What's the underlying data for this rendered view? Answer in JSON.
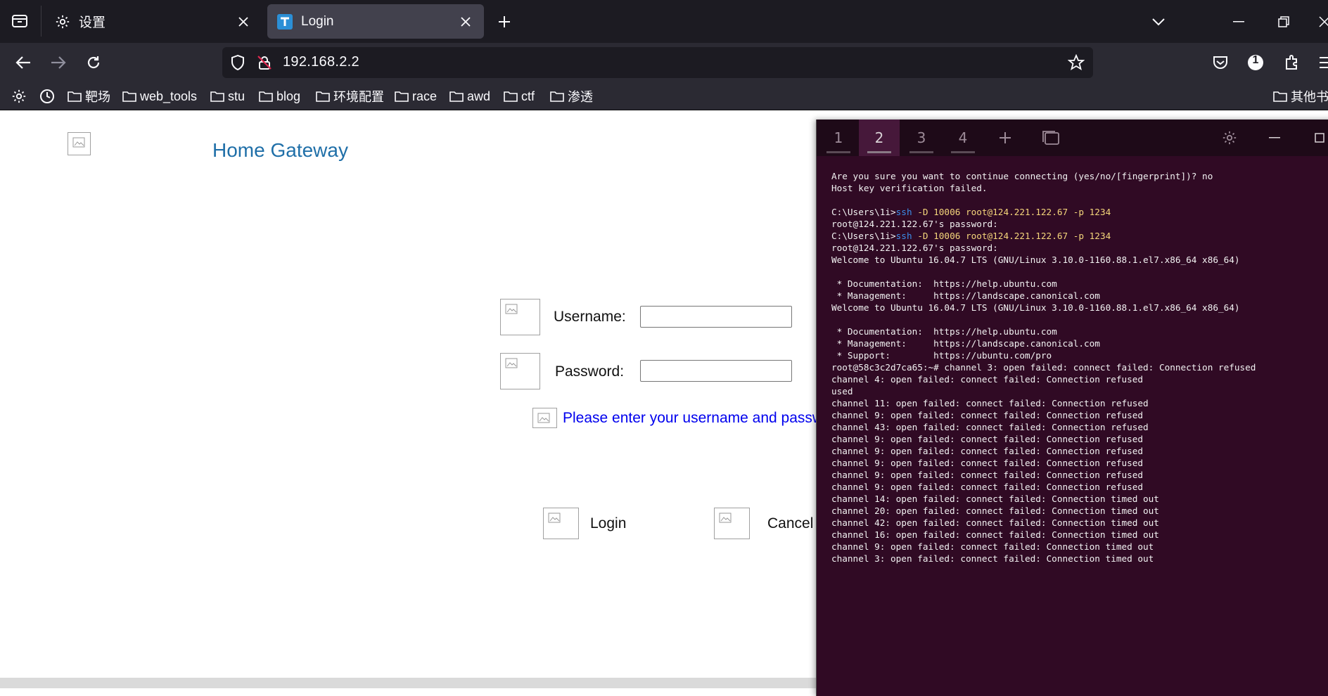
{
  "browser": {
    "tabs": [
      {
        "title": "设置",
        "active": false
      },
      {
        "title": "Login",
        "active": true
      }
    ],
    "url": "192.168.2.2",
    "bookmarks": [
      "靶场",
      "web_tools",
      "stu",
      "blog",
      "环境配置",
      "race",
      "awd",
      "ctf",
      "渗透"
    ],
    "other_bookmarks": "其他书",
    "extension_badge": "1",
    "colors": {
      "tabbar": "#1c1b22",
      "toolbar": "#2b2a33",
      "active_tab": "#42414d"
    }
  },
  "page": {
    "title": "Home Gateway",
    "username_label": "Username:",
    "password_label": "Password:",
    "username_value": "",
    "password_value": "",
    "hint": "Please enter your username and passwor",
    "login_label": "Login",
    "cancel_label": "Cancel",
    "colors": {
      "title": "#1f6fa8",
      "hint": "#0000ee"
    }
  },
  "terminal": {
    "tabs": [
      "1",
      "2",
      "3",
      "4"
    ],
    "active_tab": "2",
    "colors": {
      "background": "#300a24",
      "command": "#3b8eea",
      "argument": "#f5d67b"
    },
    "lines": [
      {
        "text": "Are you sure you want to continue connecting (yes/no/[fingerprint])? no"
      },
      {
        "text": "Host key verification failed."
      },
      {
        "text": ""
      },
      {
        "prompt": "C:\\Users\\1i>",
        "cmd": "ssh",
        "args": " -D 10006 root@124.221.122.67 -p 1234"
      },
      {
        "text": "root@124.221.122.67's password:"
      },
      {
        "prompt": "C:\\Users\\1i>",
        "cmd": "ssh",
        "args": " -D 10006 root@124.221.122.67 -p 1234"
      },
      {
        "text": "root@124.221.122.67's password:"
      },
      {
        "text": "Welcome to Ubuntu 16.04.7 LTS (GNU/Linux 3.10.0-1160.88.1.el7.x86_64 x86_64)"
      },
      {
        "text": ""
      },
      {
        "text": " * Documentation:  https://help.ubuntu.com"
      },
      {
        "text": " * Management:     https://landscape.canonical.com"
      },
      {
        "text": "Welcome to Ubuntu 16.04.7 LTS (GNU/Linux 3.10.0-1160.88.1.el7.x86_64 x86_64)"
      },
      {
        "text": ""
      },
      {
        "text": " * Documentation:  https://help.ubuntu.com"
      },
      {
        "text": " * Management:     https://landscape.canonical.com"
      },
      {
        "text": " * Support:        https://ubuntu.com/pro"
      },
      {
        "text": "root@58c3c2d7ca65:~# channel 3: open failed: connect failed: Connection refused"
      },
      {
        "text": "channel 4: open failed: connect failed: Connection refused"
      },
      {
        "text": "used"
      },
      {
        "text": "channel 11: open failed: connect failed: Connection refused"
      },
      {
        "text": "channel 9: open failed: connect failed: Connection refused"
      },
      {
        "text": "channel 43: open failed: connect failed: Connection refused"
      },
      {
        "text": "channel 9: open failed: connect failed: Connection refused"
      },
      {
        "text": "channel 9: open failed: connect failed: Connection refused"
      },
      {
        "text": "channel 9: open failed: connect failed: Connection refused"
      },
      {
        "text": "channel 9: open failed: connect failed: Connection refused"
      },
      {
        "text": "channel 9: open failed: connect failed: Connection refused"
      },
      {
        "text": "channel 14: open failed: connect failed: Connection timed out"
      },
      {
        "text": "channel 20: open failed: connect failed: Connection timed out"
      },
      {
        "text": "channel 42: open failed: connect failed: Connection timed out"
      },
      {
        "text": "channel 16: open failed: connect failed: Connection timed out"
      },
      {
        "text": "channel 9: open failed: connect failed: Connection timed out"
      },
      {
        "text": "channel 3: open failed: connect failed: Connection timed out"
      }
    ]
  }
}
